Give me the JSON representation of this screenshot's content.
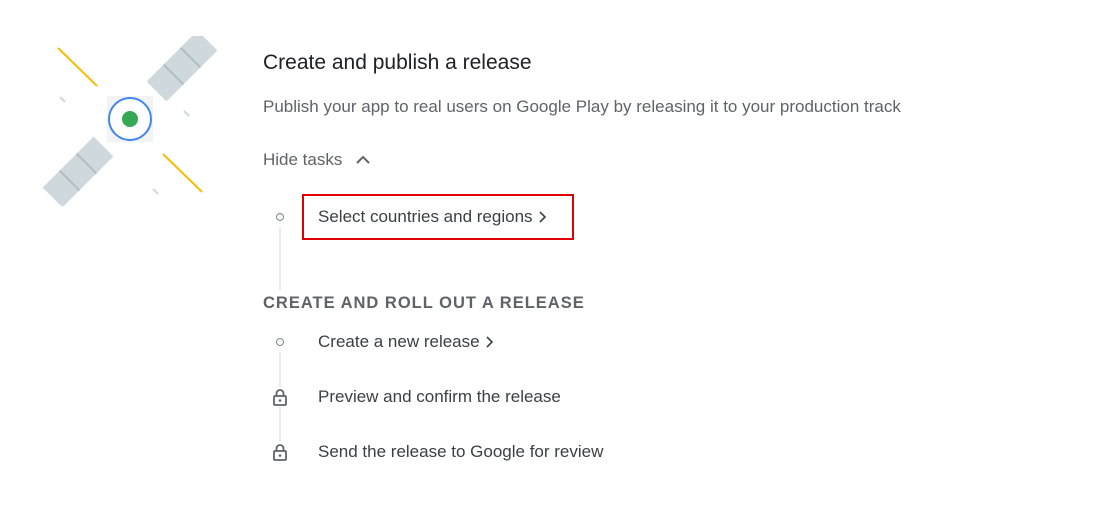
{
  "header": {
    "title": "Create and publish a release",
    "subtitle": "Publish your app to real users on Google Play by releasing it to your production track"
  },
  "toggle": {
    "label": "Hide tasks",
    "icon": "chevron-up-icon"
  },
  "tasks_group_1": [
    {
      "label": "Select countries and regions",
      "status": "open",
      "has_link": true
    }
  ],
  "section": {
    "heading": "CREATE AND ROLL OUT A RELEASE"
  },
  "tasks_group_2": [
    {
      "label": "Create a new release",
      "status": "open",
      "has_link": true
    },
    {
      "label": "Preview and confirm the release",
      "status": "locked",
      "has_link": false
    },
    {
      "label": "Send the release to Google for review",
      "status": "locked",
      "has_link": false
    }
  ],
  "colors": {
    "highlight": "#e00000",
    "satellite_dot": "#34a853",
    "satellite_ring": "#4285f4",
    "satellite_rays": "#fbbc04",
    "satellite_panels": "#cfd8dc"
  }
}
